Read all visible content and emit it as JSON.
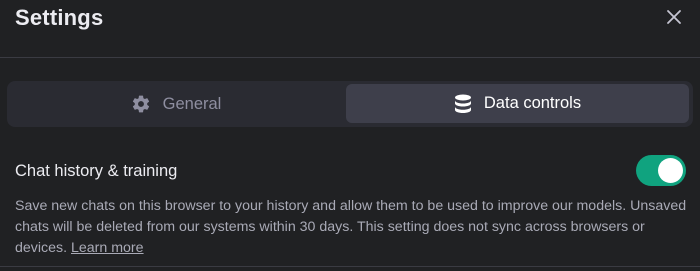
{
  "dialog": {
    "title": "Settings",
    "close_icon": "close-icon"
  },
  "tabs": [
    {
      "label": "General",
      "icon": "gear-icon",
      "active": false
    },
    {
      "label": "Data controls",
      "icon": "database-icon",
      "active": true
    }
  ],
  "chat_history": {
    "label": "Chat history & training",
    "enabled": true,
    "description": "Save new chats on this browser to your history and allow them to be used to improve our models. Unsaved chats will be deleted from our systems within 30 days. This setting does not sync across browsers or devices.",
    "link_text": "Learn more"
  },
  "colors": {
    "background": "#202123",
    "active_tab": "#3e3f4b",
    "toggle_on": "#10a37f"
  }
}
